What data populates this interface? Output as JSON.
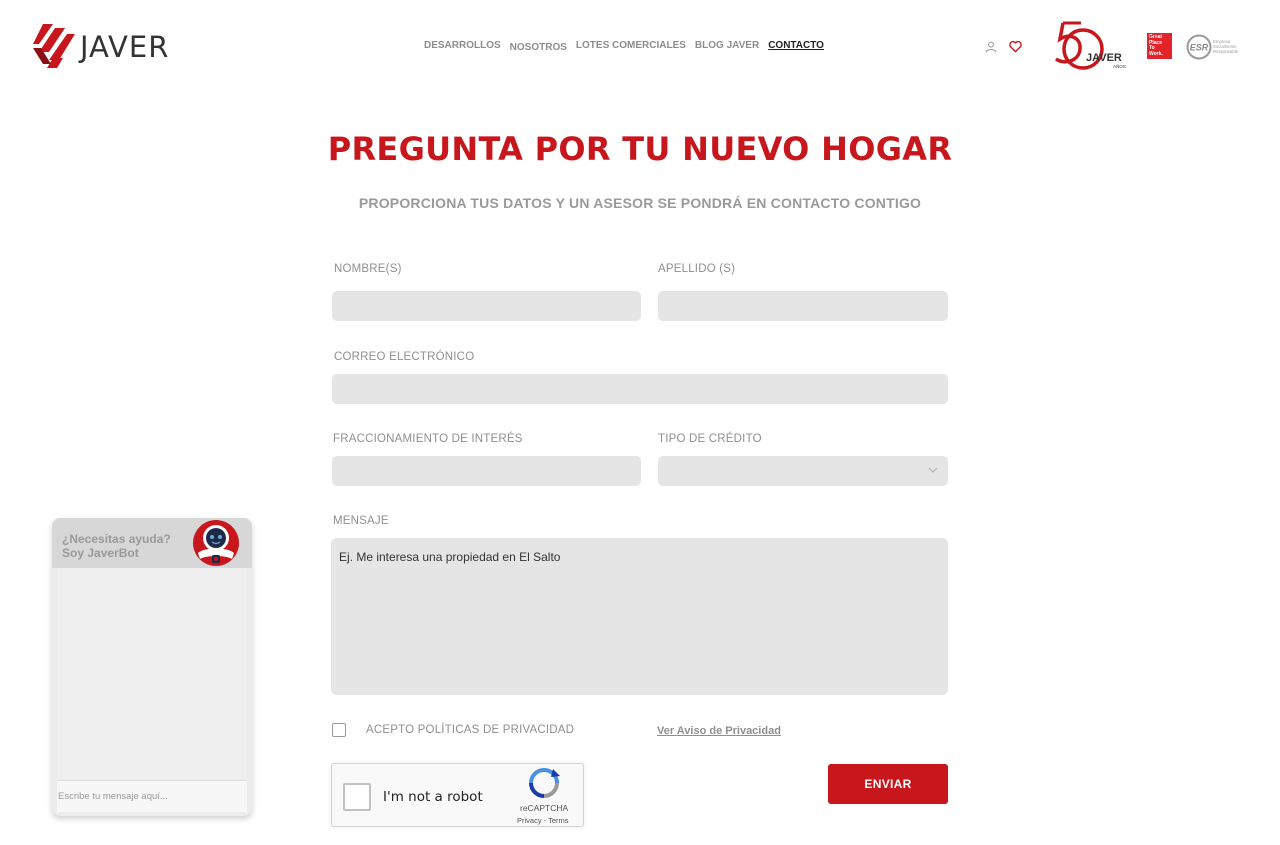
{
  "brand": {
    "name": "JAVER",
    "accent": "#c8161d"
  },
  "nav": {
    "items": [
      "DESARROLLOS",
      "NOSOTROS",
      "LOTES COMERCIALES",
      "BLOG JAVER",
      "CONTACTO"
    ],
    "active": "CONTACTO"
  },
  "header_icons": [
    "user-icon",
    "heart-icon"
  ],
  "badges": {
    "anniversary": {
      "number": "50",
      "brand": "JAVER",
      "suffix": "AÑOS"
    },
    "gptw": [
      "Great",
      "Place",
      "To",
      "Work."
    ],
    "esr": {
      "mark": "ESR",
      "lines": [
        "Empresa",
        "Socialmente",
        "Responsable"
      ]
    }
  },
  "main": {
    "title": "PREGUNTA POR TU NUEVO HOGAR",
    "subtitle": "PROPORCIONA TUS DATOS Y UN ASESOR SE PONDRÁ EN CONTACTO CONTIGO"
  },
  "form": {
    "nombre_label": "NOMBRE(S)",
    "apellido_label": "APELLIDO (S)",
    "correo_label": "CORREO ELECTRÓNICO",
    "fraccionamiento_label": "FRACCIONAMIENTO DE INTERÉS",
    "credito_label": "TIPO DE CRÉDITO",
    "mensaje_label": "MENSAJE",
    "mensaje_placeholder": "Ej. Me interesa una propiedad en El Salto",
    "privacy_label": "ACEPTO POLÍTICAS DE PRIVACIDAD",
    "privacy_link": "Ver Aviso de Privacidad",
    "submit_label": "ENVIAR"
  },
  "recaptcha": {
    "text": "I'm not a robot",
    "brand": "reCAPTCHA",
    "terms": "Privacy - Terms"
  },
  "chat": {
    "title_line1": "¿Necesitas ayuda?",
    "title_line2": "Soy JaverBot",
    "input_placeholder": "Escribe tu mensaje aquí..."
  }
}
